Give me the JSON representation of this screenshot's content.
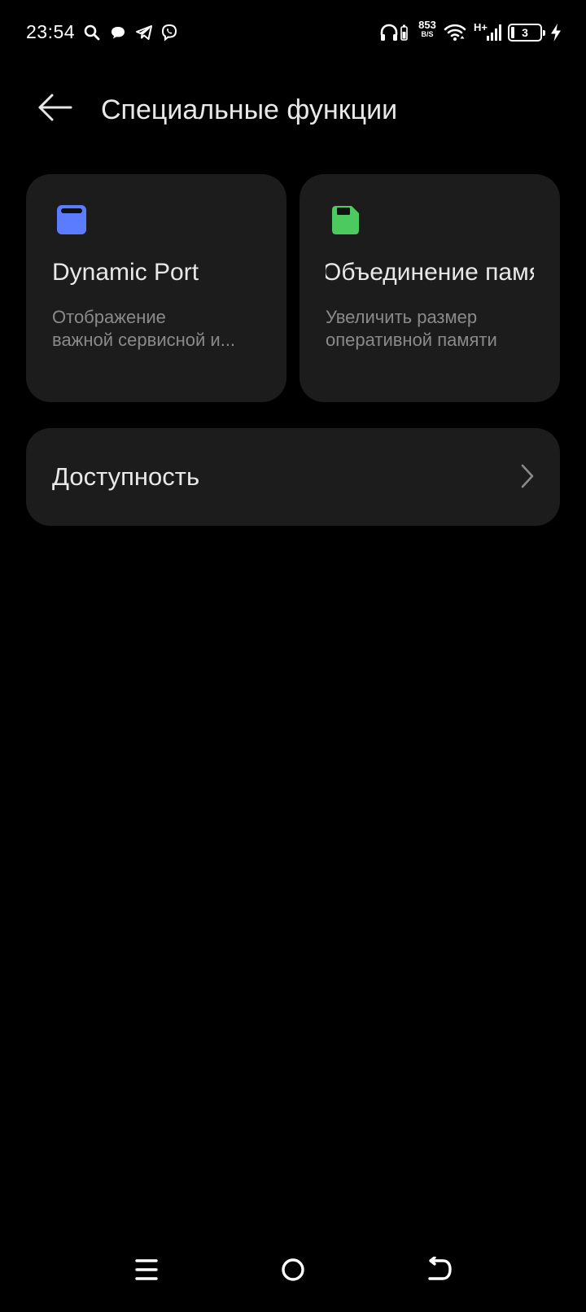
{
  "status_bar": {
    "time": "23:54",
    "net_speed_value": "853",
    "net_speed_unit": "B/S",
    "network_type": "H+",
    "battery_level": "3",
    "icons": [
      "search-icon",
      "message-icon",
      "telegram-icon",
      "viber-icon",
      "headphones-icon",
      "wifi-icon",
      "signal-icon",
      "charging-icon"
    ]
  },
  "header": {
    "title": "Специальные функции"
  },
  "cards": [
    {
      "title": "Dynamic Port",
      "description_line1": "Отображение",
      "description_line2": "важной сервисной и...",
      "icon": "window-icon",
      "icon_color": "#5b7cff"
    },
    {
      "title": "Объединение памяти",
      "description_line1": "Увеличить размер",
      "description_line2": "оперативной памяти",
      "icon": "sd-card-icon",
      "icon_color": "#4cc95f"
    }
  ],
  "list": [
    {
      "label": "Доступность"
    }
  ],
  "nav_bar": {
    "buttons": [
      "menu-icon",
      "home-icon",
      "back-gesture-icon"
    ]
  }
}
